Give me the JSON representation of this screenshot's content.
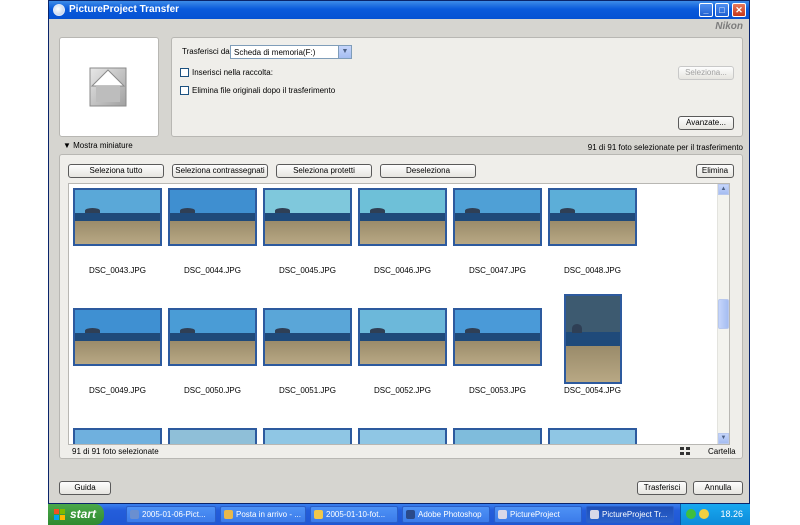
{
  "window": {
    "title": "PictureProject Transfer",
    "brand": "Nikon",
    "controls": {
      "minimize": "_",
      "maximize": "□",
      "close": "✕"
    }
  },
  "source": {
    "label": "Trasferisci da:",
    "value": "Scheda di memoria(F:)"
  },
  "options": {
    "add_to_collection": "Inserisci nella raccolta:",
    "delete_originals": "Elimina file originali dopo il trasferimento",
    "select_button": "Seleziona...",
    "advanced_button": "Avanzate..."
  },
  "thumbnails_toggle": "▼ Mostra miniature",
  "selection_count": "91 di 91 foto selezionate per il trasferimento",
  "toolbar": {
    "select_all": "Seleziona tutto",
    "select_marked": "Seleziona contrassegnati",
    "select_protected": "Seleziona protetti",
    "deselect": "Deseleziona",
    "delete": "Elimina"
  },
  "photos": [
    {
      "name": "DSC_0043.JPG",
      "sky": "#5aa8d8"
    },
    {
      "name": "DSC_0044.JPG",
      "sky": "#3f8fd0"
    },
    {
      "name": "DSC_0045.JPG",
      "sky": "#7fc8dc"
    },
    {
      "name": "DSC_0046.JPG",
      "sky": "#6ec0d8"
    },
    {
      "name": "DSC_0047.JPG",
      "sky": "#4fa0d6"
    },
    {
      "name": "DSC_0048.JPG",
      "sky": "#5caed8"
    },
    {
      "name": "DSC_0049.JPG",
      "sky": "#3f90d2"
    },
    {
      "name": "DSC_0050.JPG",
      "sky": "#4a9cd6"
    },
    {
      "name": "DSC_0051.JPG",
      "sky": "#5aa6d8"
    },
    {
      "name": "DSC_0052.JPG",
      "sky": "#6cb8da"
    },
    {
      "name": "DSC_0053.JPG",
      "sky": "#4a9ad8"
    },
    {
      "name": "DSC_0054.JPG",
      "sky": "#3d5a70"
    },
    {
      "name": "",
      "sky": "#6fb0de"
    },
    {
      "name": "",
      "sky": "#8fbfd8"
    },
    {
      "name": "",
      "sky": "#8fc6e4"
    },
    {
      "name": "",
      "sky": "#8fc6e4"
    },
    {
      "name": "",
      "sky": "#7fbcdc"
    },
    {
      "name": "",
      "sky": "#8fc6e4"
    }
  ],
  "status": {
    "selected": "91 di 91 foto selezionate",
    "sort_label": "Cartella"
  },
  "footer": {
    "help": "Guida",
    "transfer": "Trasferisci",
    "cancel": "Annulla"
  },
  "taskbar": {
    "start": "start",
    "items": [
      {
        "label": "2005-01-06-Pict...",
        "icon_color": "#6a8fd0"
      },
      {
        "label": "Posta in arrivo - ...",
        "icon_color": "#e8b84a"
      },
      {
        "label": "2005-01-10-fot...",
        "icon_color": "#f0c84a"
      },
      {
        "label": "Adobe Photoshop",
        "icon_color": "#2a4a8a"
      },
      {
        "label": "PictureProject",
        "icon_color": "#d8d8e8"
      },
      {
        "label": "PictureProject Tr...",
        "icon_color": "#d8d8e8"
      }
    ],
    "clock": "18.26"
  }
}
